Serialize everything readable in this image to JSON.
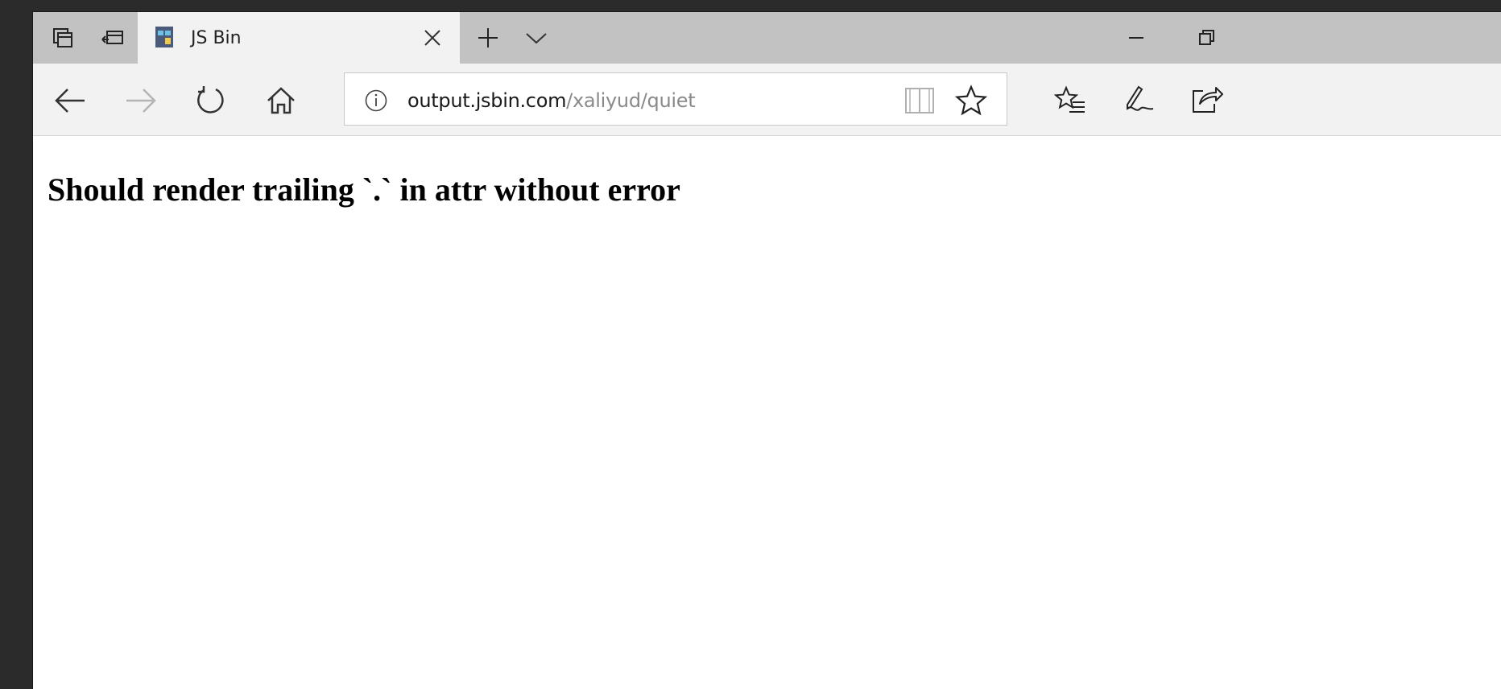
{
  "browser": {
    "tab": {
      "title": "JS Bin"
    },
    "address": {
      "host": "output.jsbin.com",
      "path": "/xaliyud/quiet"
    }
  },
  "page": {
    "heading": "Should render trailing `.` in attr without error"
  },
  "icons": {
    "tab_actions": "tab-actions-icon",
    "set_aside_tabs": "set-aside-tabs-icon",
    "favicon": "jsbin-favicon-icon",
    "tab_close": "close-icon",
    "new_tab": "plus-icon",
    "tab_preview": "chevron-down-icon",
    "minimize": "minimize-icon",
    "restore": "restore-icon",
    "back": "arrow-left-icon",
    "forward": "arrow-right-icon",
    "refresh": "refresh-icon",
    "home": "home-icon",
    "info": "info-icon",
    "reading_view": "book-icon",
    "favorite": "star-icon",
    "favorites_hub": "favorites-list-icon",
    "web_note": "pen-icon",
    "share": "share-icon"
  },
  "colors": {
    "titlebar": "#c2c2c2",
    "toolbar": "#f2f2f2",
    "url_path": "#8a8a8a"
  }
}
